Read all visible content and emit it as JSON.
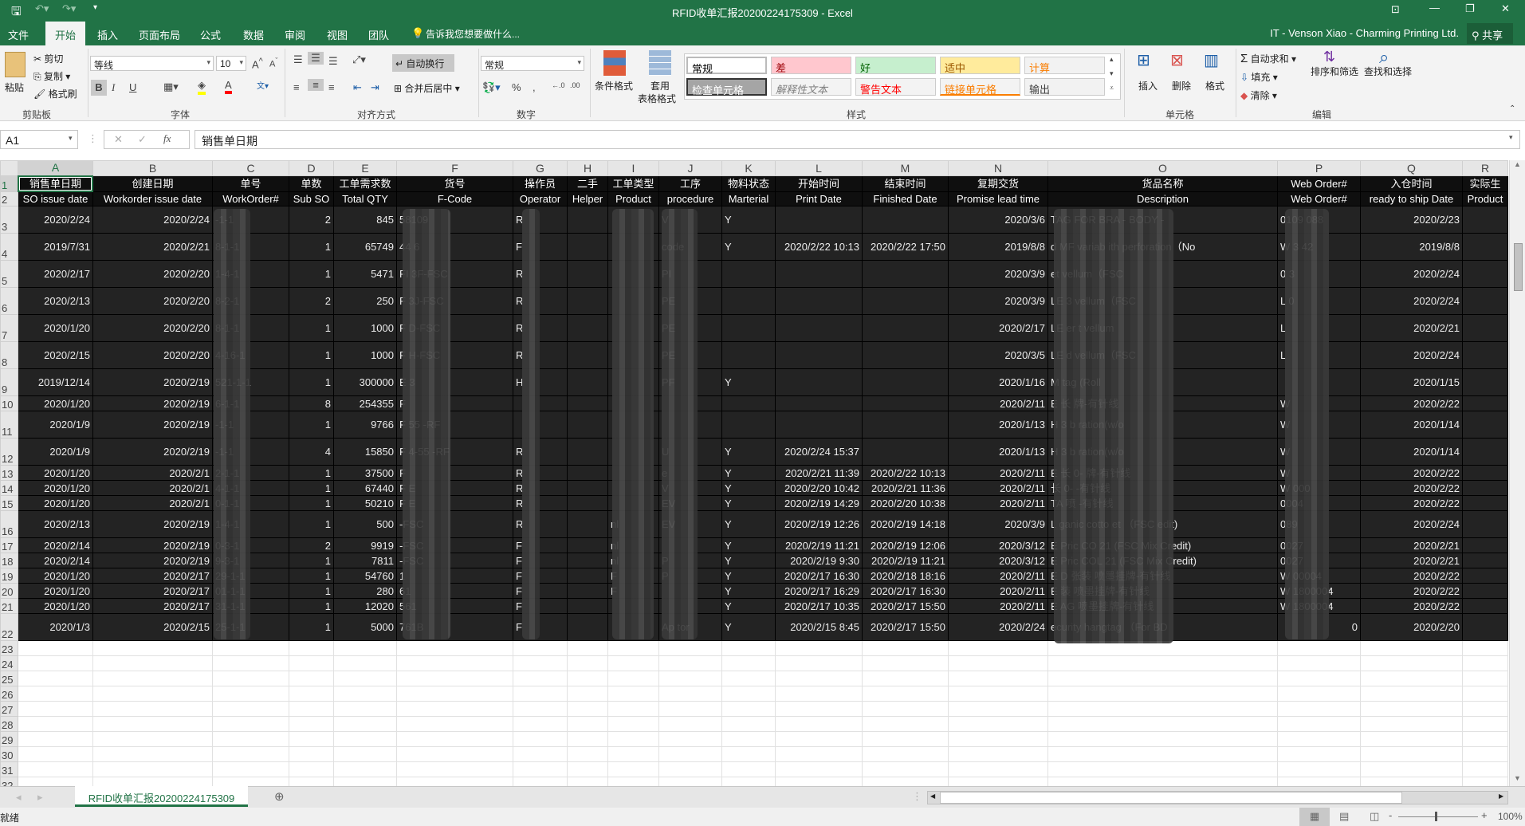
{
  "title_bar": {
    "title": "RFID收单汇报20200224175309 - Excel"
  },
  "ribbon_tabs": [
    "文件",
    "开始",
    "插入",
    "页面布局",
    "公式",
    "数据",
    "审阅",
    "视图",
    "团队"
  ],
  "tell_me": "告诉我您想要做什么...",
  "account": "IT - Venson Xiao - Charming Printing Ltd.",
  "share": "共享",
  "ribbon": {
    "clipboard": {
      "paste": "粘贴",
      "cut": "剪切",
      "copy": "复制",
      "format_painter": "格式刷",
      "label": "剪贴板"
    },
    "font": {
      "name": "等线",
      "size": "10",
      "label": "字体",
      "bold": "B",
      "italic": "I",
      "underline": "U",
      "fill_color": "#ffff00",
      "font_color": "#ff0000"
    },
    "alignment": {
      "wrap": "自动换行",
      "merge": "合并后居中",
      "label": "对齐方式"
    },
    "number": {
      "format": "常规",
      "label": "数字"
    },
    "styles": {
      "conditional": "条件格式",
      "table_format_1": "套用",
      "table_format_2": "表格格式",
      "label": "样式",
      "cells": [
        {
          "label": "常规",
          "bg": "#ffffff",
          "color": "#000000"
        },
        {
          "label": "差",
          "bg": "#ffc7ce",
          "color": "#9c0006"
        },
        {
          "label": "好",
          "bg": "#c6efce",
          "color": "#006100"
        },
        {
          "label": "适中",
          "bg": "#ffeb9c",
          "color": "#9c5700"
        },
        {
          "label": "计算",
          "bg": "#f2f2f2",
          "color": "#fa7d00"
        },
        {
          "label": "检查单元格",
          "bg": "#a5a5a5",
          "color": "#ffffff"
        },
        {
          "label": "解释性文本",
          "bg": "#f3f3f3",
          "color": "#7f7f7f"
        },
        {
          "label": "警告文本",
          "bg": "#f3f3f3",
          "color": "#ff0000"
        },
        {
          "label": "链接单元格",
          "bg": "#f3f3f3",
          "color": "#fa7d00"
        },
        {
          "label": "输出",
          "bg": "#f2f2f2",
          "color": "#3f3f3f"
        }
      ]
    },
    "cells": {
      "insert": "插入",
      "delete": "删除",
      "format": "格式",
      "label": "单元格"
    },
    "editing": {
      "autosum": "自动求和",
      "fill": "填充",
      "clear": "清除",
      "sort": "排序和筛选",
      "find": "查找和选择",
      "label": "编辑"
    }
  },
  "formula_bar": {
    "name_box": "A1",
    "formula": "销售单日期"
  },
  "grid": {
    "columns": [
      "A",
      "B",
      "C",
      "D",
      "E",
      "F",
      "G",
      "H",
      "I",
      "J",
      "K",
      "L",
      "M",
      "N",
      "O",
      "P",
      "Q",
      "R"
    ],
    "header_rows": [
      [
        "销售单日期",
        "创建日期",
        "单号",
        "单数",
        "工单需求数",
        "货号",
        "操作员",
        "二手",
        "工单类型",
        "工序",
        "物料状态",
        "开始时间",
        "结束时间",
        "复期交货",
        "货品名称",
        "Web Order#",
        "入仓时间",
        "实际生"
      ],
      [
        "SO issue date",
        "Workorder issue date",
        "WorkOrder#",
        "Sub SO",
        "Total QTY",
        "F-Code",
        "Operator",
        "Helper",
        "Product",
        "procedure",
        "Marterial",
        "Print Date",
        "Finished Date",
        "Promise lead time",
        "Description",
        "Web Order#",
        "ready to ship Date",
        "Product"
      ]
    ],
    "rows": [
      [
        "2020/2/24",
        "2020/2/24",
        "-1-1",
        "2",
        "845",
        "58109",
        "R",
        "",
        "",
        "V",
        "Y",
        "",
        "",
        "2020/3/6",
        "TAG FOR BRA - BODY -",
        "0109 088",
        "2020/2/23",
        ""
      ],
      [
        "2019/7/31",
        "2020/2/21",
        "8-1-1",
        "1",
        "65749",
        "44 6",
        "F",
        "",
        "",
        "code",
        "Y",
        "2020/2/22 10:13",
        "2020/2/22 17:50",
        "2019/8/8",
        "d MF variab ith perforation（No",
        "W 3 42",
        "2019/8/8",
        ""
      ],
      [
        "2020/2/17",
        "2020/2/20",
        "1-4-1",
        "1",
        "5471",
        "FI 3F-FSC",
        "R",
        "",
        "",
        "PI",
        "",
        "",
        "",
        "2020/3/9",
        "et vellum（FSC",
        "0 3",
        "2020/2/24",
        ""
      ],
      [
        "2020/2/13",
        "2020/2/20",
        "8-2-1",
        "2",
        "250",
        "F 3J-FSC",
        "R",
        "",
        "",
        "PE",
        "",
        "",
        "",
        "2020/3/9",
        "LE 3 vellum（FSC",
        "L 0",
        "2020/2/24",
        ""
      ],
      [
        "2020/1/20",
        "2020/2/20",
        "8-1-1",
        "1",
        "1000",
        "F D-FSC",
        "R",
        "",
        "",
        "PE",
        "",
        "",
        "",
        "2020/2/17",
        "LE er t vellum",
        "L",
        "2020/2/21",
        ""
      ],
      [
        "2020/2/15",
        "2020/2/20",
        "4-16-1",
        "1",
        "1000",
        "F H-FSC",
        "R",
        "",
        "",
        "PE",
        "",
        "",
        "",
        "2020/3/5",
        "LE d vellum（FSC",
        "L",
        "2020/2/24",
        ""
      ],
      [
        "2019/12/14",
        "2020/2/19",
        "521-1-1",
        "1",
        "300000",
        "E 3",
        "H",
        "",
        "",
        "PF",
        "Y",
        "",
        "",
        "2020/1/16",
        "M tag (Roll",
        "",
        "2020/1/15",
        ""
      ],
      [
        "2020/1/20",
        "2020/2/19",
        "6-1-1",
        "8",
        "254355",
        "F",
        "",
        "",
        "",
        "",
        "",
        "",
        "",
        "2020/2/11",
        "E 长 牌-有针线",
        "W",
        "2020/2/22",
        ""
      ],
      [
        "2020/1/9",
        "2020/2/19",
        "-1-1",
        "1",
        "9766",
        "F 55 -RF",
        "",
        "",
        "",
        "",
        "",
        "",
        "",
        "2020/1/13",
        "H 3 b ration(w/o",
        "W",
        "2020/1/14",
        ""
      ],
      [
        "2020/1/9",
        "2020/2/19",
        "-1-1",
        "4",
        "15850",
        "F 4-55 -RF",
        "R",
        "",
        "",
        "U",
        "Y",
        "2020/2/24 15:37",
        "",
        "2020/1/13",
        "H 3 b ration(w/o",
        "W",
        "2020/1/14",
        ""
      ],
      [
        "2020/1/20",
        "2020/2/1",
        "2-1-1",
        "1",
        "37500",
        "F",
        "R",
        "",
        "",
        "e",
        "Y",
        "2020/2/21 11:39",
        "2020/2/22 10:13",
        "2020/2/11",
        "E 长 0- 牌-有针线",
        "W",
        "2020/2/22",
        ""
      ],
      [
        "2020/1/20",
        "2020/2/1",
        "4-1-1",
        "1",
        "67440",
        "F E",
        "R",
        "",
        "",
        "V",
        "Y",
        "2020/2/20 10:42",
        "2020/2/21 11:36",
        "2020/2/11",
        "长 0- -有针线",
        "W 000",
        "2020/2/22",
        ""
      ],
      [
        "2020/1/20",
        "2020/2/1",
        "0-1-1",
        "1",
        "50210",
        "F E",
        "R",
        "",
        "",
        "EV",
        "Y",
        "2020/2/19 14:29",
        "2020/2/20 10:38",
        "2020/2/11",
        "TA 喷 -有针线",
        "0004",
        "2020/2/22",
        ""
      ],
      [
        "2020/2/13",
        "2020/2/19",
        "1-4-1",
        "1",
        "500",
        "-FSC",
        "R",
        "",
        "nl",
        "EV",
        "Y",
        "2020/2/19 12:26",
        "2020/2/19 14:18",
        "2020/3/9",
        "L ganic cotto et （FSC edit)",
        "089",
        "2020/2/24",
        ""
      ],
      [
        "2020/2/14",
        "2020/2/19",
        "0-3-1",
        "2",
        "9919",
        "-FSC",
        "F",
        "",
        "nl",
        "",
        "Y",
        "2020/2/19 11:21",
        "2020/2/19 12:06",
        "2020/3/12",
        "E Pric CO 21 (FSC Mix Credit)",
        "0027",
        "2020/2/21",
        ""
      ],
      [
        "2020/2/14",
        "2020/2/19",
        "9-3-1",
        "1",
        "7811",
        "-FSC",
        "F",
        "",
        "nl",
        "P",
        "Y",
        "2020/2/19 9:30",
        "2020/2/19 11:21",
        "2020/3/12",
        "E Pric COL 21 (FSC Mix Credit)",
        "0027",
        "2020/2/21",
        ""
      ],
      [
        "2020/1/20",
        "2020/2/17",
        "29-1-1",
        "1",
        "54760",
        "1",
        "F",
        "",
        "F",
        "P",
        "Y",
        "2020/2/17 16:30",
        "2020/2/18 18:16",
        "2020/2/11",
        "E D 张装 喷墨挂牌-有针线",
        "W 00004",
        "2020/2/22",
        ""
      ],
      [
        "2020/1/20",
        "2020/2/17",
        "01-1-1",
        "1",
        "280",
        "61",
        "F",
        "",
        "F",
        "",
        "Y",
        "2020/2/17 16:29",
        "2020/2/17 16:30",
        "2020/2/11",
        "E 装 喷墨挂牌-有针线",
        "W 1800004",
        "2020/2/22",
        ""
      ],
      [
        "2020/1/20",
        "2020/2/17",
        "31-1-1",
        "1",
        "12020",
        "561",
        "F",
        "",
        "",
        "",
        "Y",
        "2020/2/17 10:35",
        "2020/2/17 15:50",
        "2020/2/11",
        "E AG 喷墨挂牌-有针线",
        "W 1800004",
        "2020/2/22",
        ""
      ],
      [
        "2020/1/3",
        "2020/2/15",
        "25-1-1",
        "1",
        "5000",
        "761B",
        "F",
        "",
        "",
        "Ap tor",
        "Y",
        "2020/2/15 8:45",
        "2020/2/17 15:50",
        "2020/2/24",
        "ecurity hangtag （For BD",
        "0",
        "2020/2/20",
        ""
      ]
    ],
    "empty_row_count": 10
  },
  "sheet_tabs": [
    "RFID收单汇报20200224175309"
  ],
  "status": {
    "ready": "就绪",
    "zoom": "100%"
  }
}
